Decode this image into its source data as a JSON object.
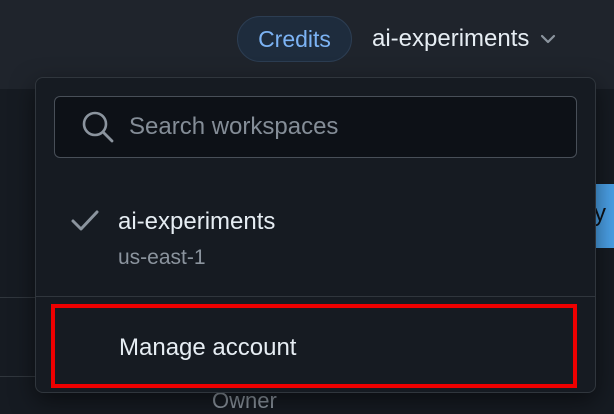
{
  "header": {
    "credits_label": "Credits",
    "workspace_label": "ai-experiments"
  },
  "background": {
    "blue_button_fragment": "y",
    "owner_label": "Owner"
  },
  "dropdown": {
    "search": {
      "placeholder": "Search workspaces",
      "value": ""
    },
    "workspaces": [
      {
        "name": "ai-experiments",
        "region": "us-east-1",
        "selected": true
      }
    ],
    "manage_account_label": "Manage account"
  },
  "colors": {
    "accent": "#7cb3f4",
    "highlight_box": "#ee0000",
    "background": "#161b22",
    "topbar": "#1f242c"
  }
}
